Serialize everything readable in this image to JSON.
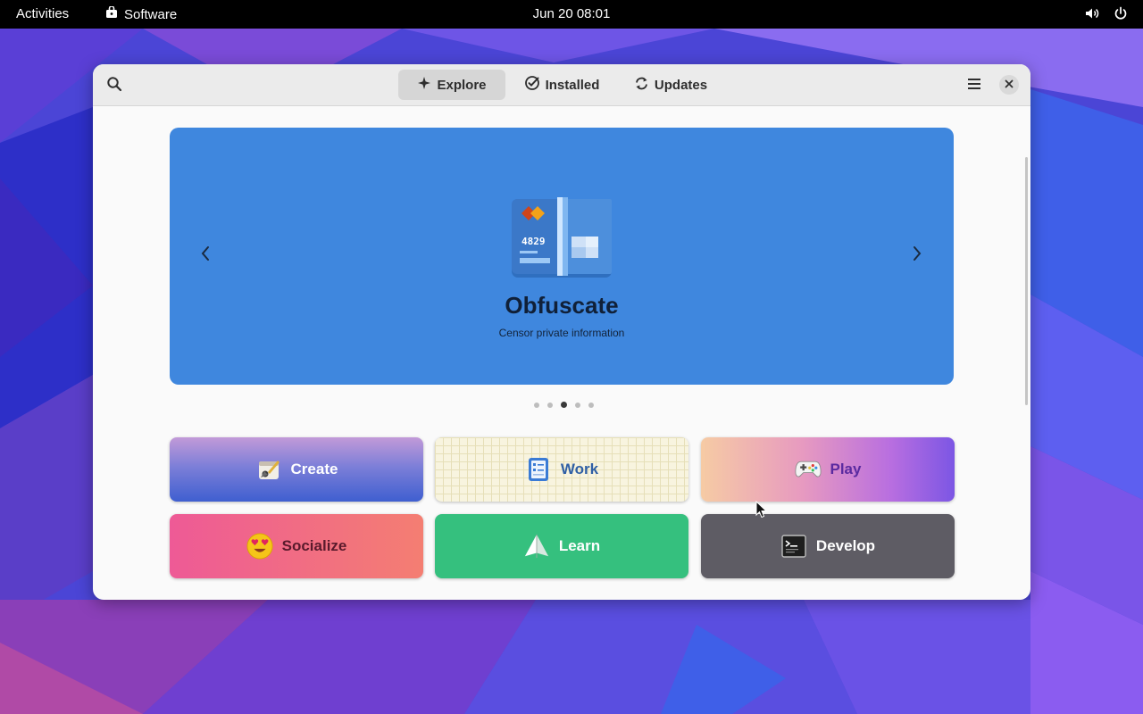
{
  "topbar": {
    "activities_label": "Activities",
    "app_name": "Software",
    "clock": "Jun 20  08:01",
    "icons": [
      "volume-icon",
      "power-icon"
    ]
  },
  "window": {
    "tabs": [
      {
        "label": "Explore",
        "icon": "sparkle-icon",
        "active": true
      },
      {
        "label": "Installed",
        "icon": "check-circle-icon",
        "active": false
      },
      {
        "label": "Updates",
        "icon": "refresh-icon",
        "active": false
      }
    ],
    "header_icons": [
      "search-icon",
      "hamburger-menu-icon",
      "close-icon"
    ]
  },
  "banner": {
    "app_name": "Obfuscate",
    "app_description": "Censor private information",
    "icon_text": "4829",
    "background": "#3f87de",
    "carousel_dots": 5,
    "active_dot": 3
  },
  "categories": [
    {
      "label": "Create",
      "icon": "create-icon"
    },
    {
      "label": "Work",
      "icon": "work-icon"
    },
    {
      "label": "Play",
      "icon": "gamepad-icon"
    },
    {
      "label": "Socialize",
      "icon": "smiley-icon"
    },
    {
      "label": "Learn",
      "icon": "learn-icon"
    },
    {
      "label": "Develop",
      "icon": "terminal-icon"
    }
  ],
  "colors": {
    "accent": "#3f87de",
    "socialize": "#ee5a96",
    "learn": "#35c07e",
    "develop": "#5e5c64"
  }
}
